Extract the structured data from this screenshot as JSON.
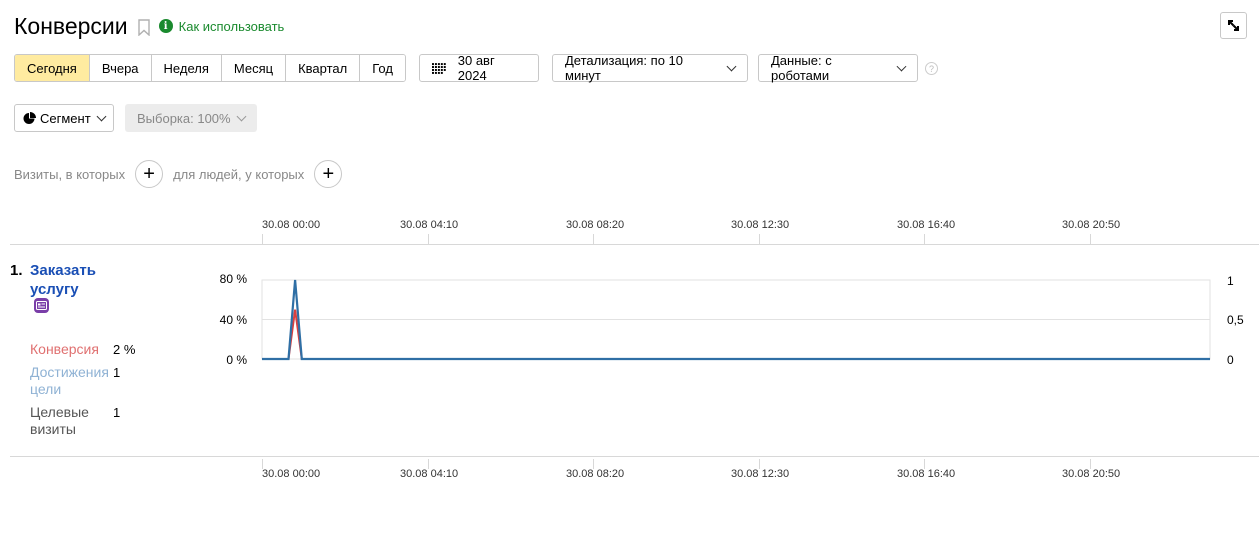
{
  "header": {
    "title": "Конверсии",
    "howto_label": "Как использовать"
  },
  "periods": [
    {
      "label": "Сегодня",
      "active": true
    },
    {
      "label": "Вчера",
      "active": false
    },
    {
      "label": "Неделя",
      "active": false
    },
    {
      "label": "Месяц",
      "active": false
    },
    {
      "label": "Квартал",
      "active": false
    },
    {
      "label": "Год",
      "active": false
    }
  ],
  "toolbar": {
    "date": "30 авг 2024",
    "detail": "Детализация: по 10 минут",
    "data_mode": "Данные: с роботами",
    "help": "?",
    "segment": "Сегмент",
    "sample": "Выборка: 100%"
  },
  "filters": {
    "visits_label": "Визиты, в которых",
    "people_label": "для людей, у которых",
    "plus": "+"
  },
  "timeline": {
    "labels": [
      "30.08 00:00",
      "30.08 04:10",
      "30.08 08:20",
      "30.08 12:30",
      "30.08 16:40",
      "30.08 20:50"
    ]
  },
  "goal": {
    "number": "1.",
    "name": "Заказать услугу",
    "metrics": [
      {
        "label": "Конверсия",
        "value": "2 %",
        "color": "#e07070"
      },
      {
        "label": "Достижения цели",
        "value": "1",
        "color": "#8fb2d4"
      },
      {
        "label": "Целевые визиты",
        "value": "1",
        "color": "#555555"
      }
    ]
  },
  "chart_data": {
    "type": "line",
    "x_axis": "time",
    "x_range": [
      "30.08 00:00",
      "30.08 23:50"
    ],
    "x_step": "10 minutes",
    "y_left_ticks": [
      "0 %",
      "40 %",
      "80 %"
    ],
    "y_left_lim": [
      0,
      80
    ],
    "y_right_ticks": [
      "0",
      "0,5",
      "1"
    ],
    "y_right_lim": [
      0,
      1
    ],
    "series": [
      {
        "name": "Конверсия",
        "axis": "left",
        "color": "#d94040",
        "points": [
          {
            "x": "30.08 00:00",
            "y": 0
          },
          {
            "x": "30.08 00:40",
            "y": 0
          },
          {
            "x": "30.08 00:50",
            "y": 50
          },
          {
            "x": "30.08 01:00",
            "y": 0
          },
          {
            "x": "30.08 23:50",
            "y": 0
          }
        ]
      },
      {
        "name": "Достижения цели",
        "axis": "right",
        "color": "#2f6fa5",
        "points": [
          {
            "x": "30.08 00:00",
            "y": 0
          },
          {
            "x": "30.08 00:40",
            "y": 0
          },
          {
            "x": "30.08 00:50",
            "y": 1
          },
          {
            "x": "30.08 01:00",
            "y": 0
          },
          {
            "x": "30.08 23:50",
            "y": 0
          }
        ]
      }
    ]
  }
}
